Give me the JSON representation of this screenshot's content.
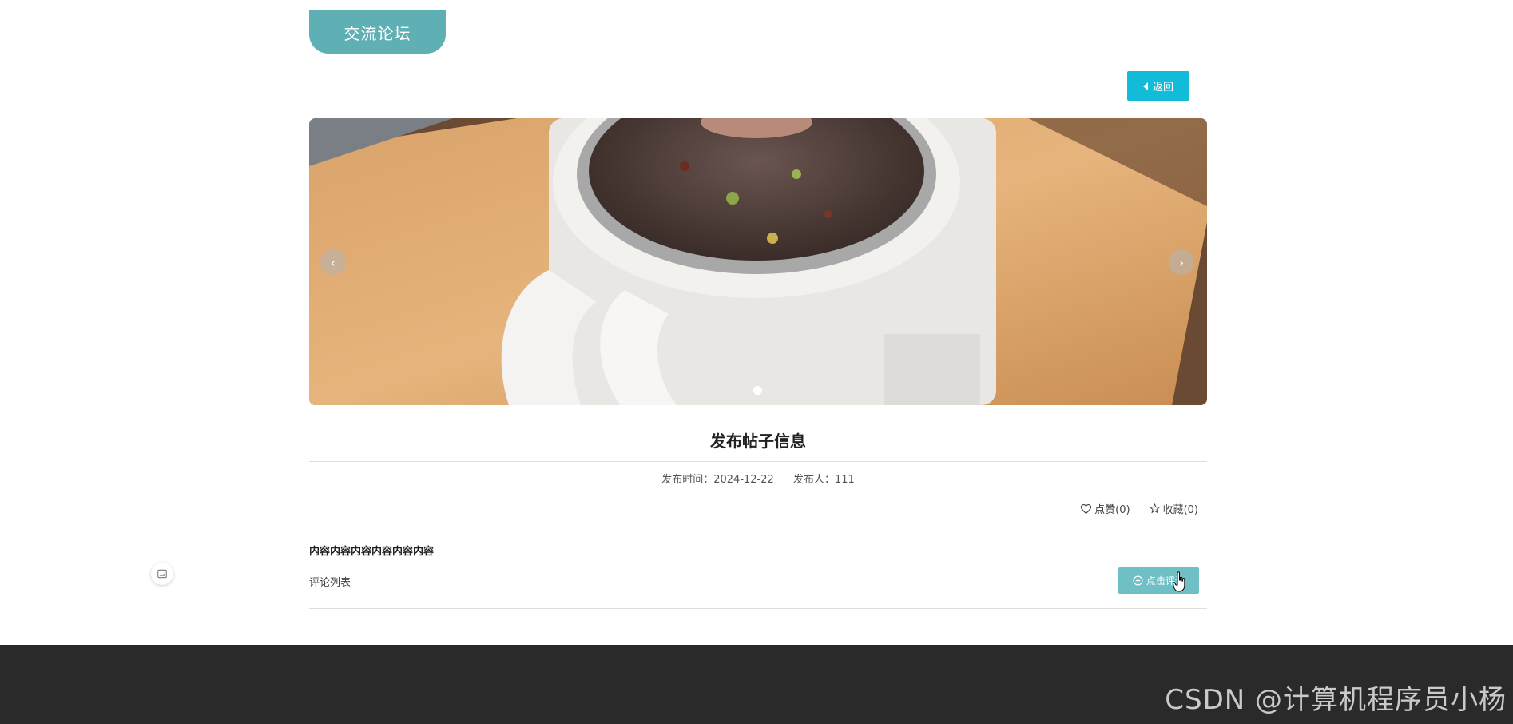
{
  "header": {
    "forum_tab_label": "交流论坛"
  },
  "toolbar": {
    "back_label": "返回"
  },
  "carousel": {
    "prev_glyph": "‹",
    "next_glyph": "›",
    "slide_count": 1,
    "active_index": 0
  },
  "post": {
    "title": "发布帖子信息",
    "publish_time_label": "发布时间：",
    "publish_time": "2024-12-22",
    "publisher_label": "发布人：",
    "publisher": "111",
    "like_label": "点赞(0)",
    "favorite_label": "收藏(0)",
    "content": "内容内容内容内容内容内容"
  },
  "comments": {
    "list_label": "评论列表",
    "add_comment_label": "点击评论"
  },
  "watermark": "CSDN @计算机程序员小杨",
  "colors": {
    "forum_tab": "#5fb0b5",
    "back_button": "#12bcd8",
    "comment_button": "#6fbfc4",
    "footer": "#2a2a2a"
  },
  "icons": {
    "back": "caret-left-icon",
    "like": "heart-icon",
    "favorite": "star-icon",
    "add_comment": "plus-circle-icon",
    "side_float": "picture-icon"
  }
}
